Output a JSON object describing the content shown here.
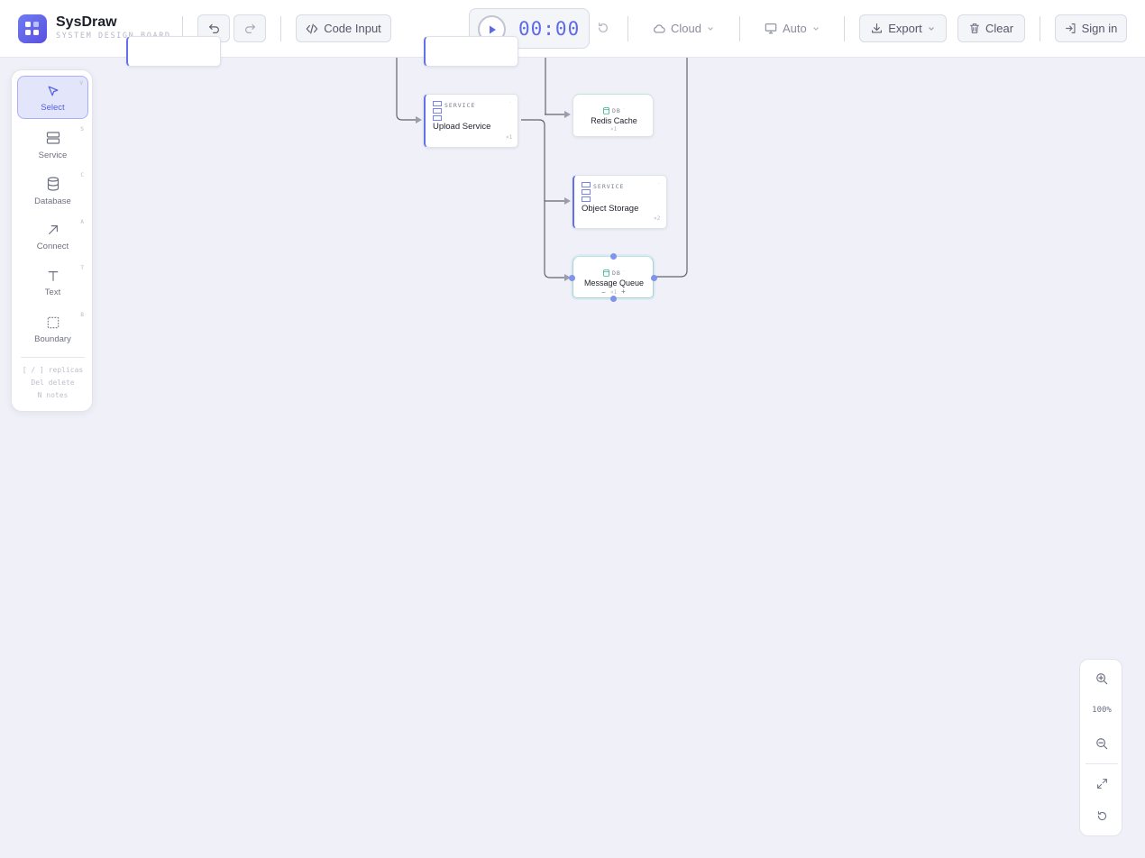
{
  "app": {
    "name": "SysDraw",
    "subtitle": "SYSTEM DESIGN BOARD"
  },
  "toolbar": {
    "code_input_label": "Code Input",
    "timer": "00:00",
    "cloud_label": "Cloud",
    "device_label": "Auto",
    "export_label": "Export",
    "clear_label": "Clear",
    "sign_in_label": "Sign in"
  },
  "tools": [
    {
      "label": "Select",
      "key": "V",
      "icon": "cursor-icon"
    },
    {
      "label": "Service",
      "key": "S",
      "icon": "server-icon"
    },
    {
      "label": "Database",
      "key": "C",
      "icon": "database-icon"
    },
    {
      "label": "Connect",
      "key": "A",
      "icon": "arrow-icon"
    },
    {
      "label": "Text",
      "key": "T",
      "icon": "text-icon"
    },
    {
      "label": "Boundary",
      "key": "B",
      "icon": "boundary-icon"
    }
  ],
  "hints": [
    "[ / ] replicas",
    "Del delete",
    "N notes"
  ],
  "nodes": {
    "upload_service": {
      "type": "SERVICE",
      "title": "Upload Service",
      "replicas": "×1"
    },
    "redis_cache": {
      "type": "DB",
      "title": "Redis Cache",
      "replicas": "×1"
    },
    "object_storage": {
      "type": "SERVICE",
      "title": "Object Storage",
      "replicas": "×2"
    },
    "message_queue": {
      "type": "DB",
      "title": "Message Queue",
      "replicas": "×1",
      "minus": "−",
      "plus": "+"
    }
  },
  "zoom": {
    "level": "100%"
  },
  "colors": {
    "accent": "#5d6ae8",
    "canvas": "#eff0f8",
    "db_accent": "#3fb892"
  }
}
